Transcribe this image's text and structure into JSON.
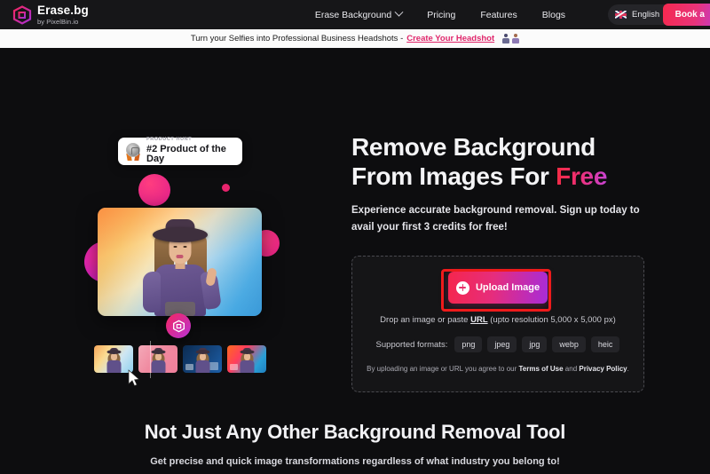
{
  "brand": {
    "name": "Erase.bg",
    "tagline": "by PixelBin.io",
    "logo_icon": "erasebg-logo-icon"
  },
  "nav": {
    "links": [
      {
        "label": "Erase Background",
        "has_dropdown": true
      },
      {
        "label": "Pricing",
        "has_dropdown": false
      },
      {
        "label": "Features",
        "has_dropdown": false
      },
      {
        "label": "Blogs",
        "has_dropdown": false
      }
    ],
    "language": {
      "label": "English",
      "flag": "uk-flag-icon",
      "chevron": "chevron-down-icon"
    },
    "cta": {
      "label": "Book a"
    }
  },
  "banner": {
    "text": "Turn your Selfies into Professional Business Headshots -",
    "link": "Create Your Headshot",
    "icons": [
      "person-icon",
      "person-icon"
    ]
  },
  "hero": {
    "badge": {
      "kicker": "PRODUCT HUNT",
      "title": "#2 Product of the Day",
      "icon": "medal-icon"
    },
    "headline_line1": "Remove Background",
    "headline_line2_prefix": "From Images For ",
    "headline_highlight": "Free",
    "subhead": "Experience accurate background removal. Sign up today to avail your first 3 credits for free!",
    "upload": {
      "button_label": "Upload Image",
      "button_icon": "plus-circle-icon",
      "drop_prefix": "Drop an image or paste ",
      "drop_link": "URL",
      "drop_suffix": " (upto resolution 5,000 x 5,000 px)",
      "formats_label": "Supported formats:",
      "formats": [
        "png",
        "jpeg",
        "jpg",
        "webp",
        "heic"
      ],
      "terms_prefix": "By uploading an image or URL you agree to our ",
      "terms_link1": "Terms of Use",
      "terms_mid": " and ",
      "terms_link2": "Privacy Policy",
      "terms_suffix": "."
    },
    "thumbnails": [
      {
        "name": "thumbnail-gradient-warm"
      },
      {
        "name": "thumbnail-pink"
      },
      {
        "name": "thumbnail-blue"
      },
      {
        "name": "thumbnail-orange-blue"
      }
    ]
  },
  "section2": {
    "title": "Not Just Any Other Background Removal Tool",
    "subtitle": "Get precise and quick image transformations regardless of what industry you belong to!"
  },
  "colors": {
    "page_bg": "#0d0d0f",
    "nav_bg": "#161618",
    "banner_bg": "#fbfbfb",
    "accent_pink": "#e8336c",
    "accent_red": "#f5264d",
    "accent_purple": "#a82cd8",
    "highlight_ring": "#ef1b1b"
  }
}
